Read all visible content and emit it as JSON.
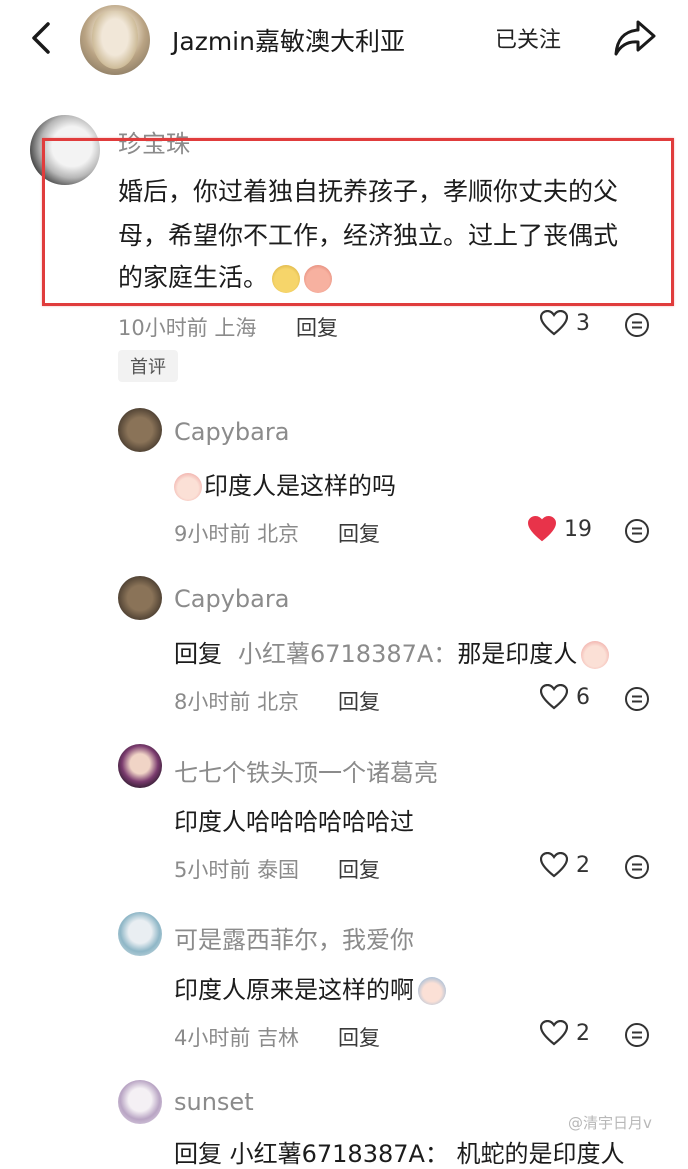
{
  "header": {
    "title": "Jazmin嘉敏澳大利亚",
    "follow_label": "已关注"
  },
  "comments": [
    {
      "user": "珍宝珠",
      "text_lines": [
        "婚后，你过着独自抚养孩子，孝顺你丈夫的父",
        "母，希望你不工作，经济独立。过上了丧偶式",
        "的家庭生活。"
      ],
      "time": "10小时前",
      "location": "上海",
      "reply_label": "回复",
      "likes": "3",
      "tag": "首评"
    },
    {
      "user": "Capybara",
      "text": "印度人是这样的吗",
      "time": "9小时前",
      "location": "北京",
      "reply_label": "回复",
      "likes": "19"
    },
    {
      "user": "Capybara",
      "reply_prefix": "回复",
      "reply_to": "小红薯6718387A：",
      "text": "那是印度人",
      "time": "8小时前",
      "location": "北京",
      "reply_label": "回复",
      "likes": "6"
    },
    {
      "user": "七七个铁头顶一个诸葛亮",
      "text": "印度人哈哈哈哈哈哈过",
      "time": "5小时前",
      "location": "泰国",
      "reply_label": "回复",
      "likes": "2"
    },
    {
      "user": "可是露西菲尔，我爱你",
      "text": "印度人原来是这样的啊",
      "time": "4小时前",
      "location": "吉林",
      "reply_label": "回复",
      "likes": "2"
    },
    {
      "user": "sunset",
      "partial_text": "回复  小红薯6718387A：  机蛇的是印度人"
    }
  ],
  "watermark": "@清宇日月v",
  "colors": {
    "highlight_border": "#e03c3c",
    "liked_heart": "#e8334a",
    "muted_text": "#8b8b8b"
  },
  "icons": [
    "back-arrow-icon",
    "share-icon",
    "heart-icon",
    "more-options-icon",
    "emoji-icon"
  ]
}
